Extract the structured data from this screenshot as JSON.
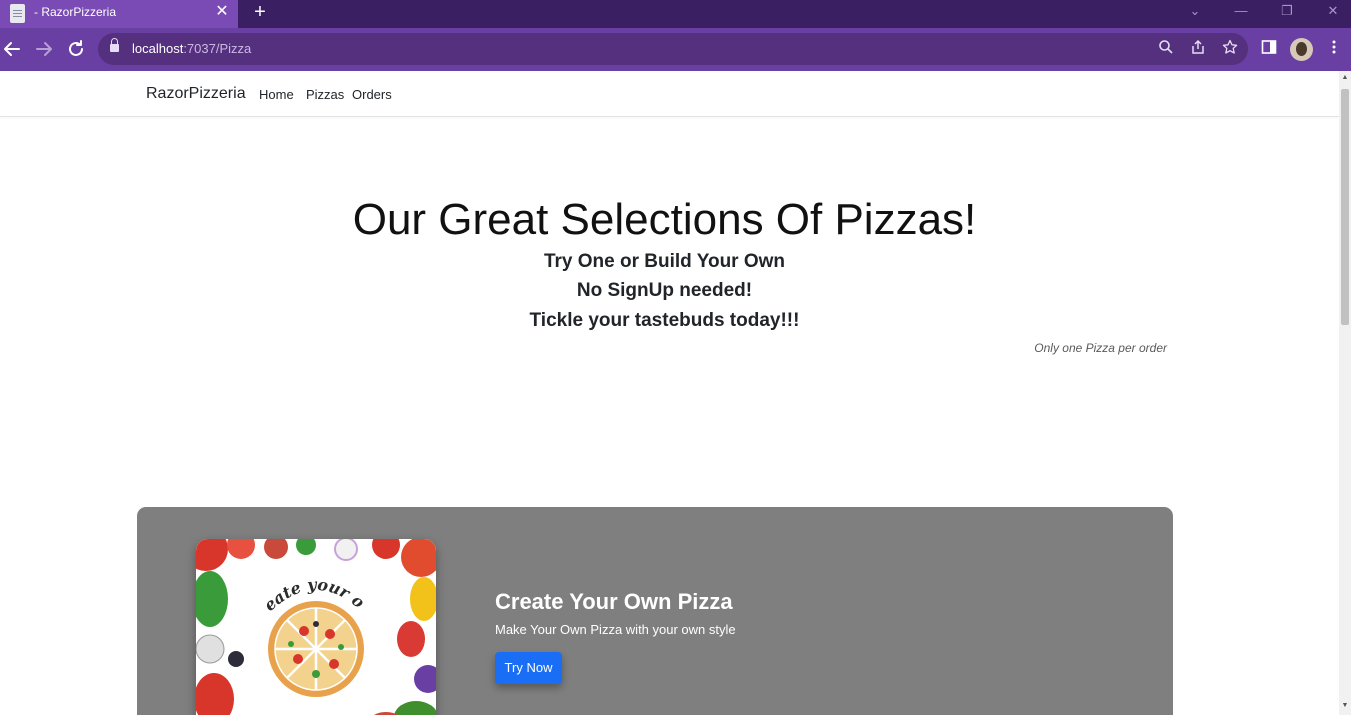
{
  "browser": {
    "tab_title": " - RazorPizzeria",
    "tab_close": "✕",
    "new_tab": "+",
    "url_host": "localhost",
    "url_rest": ":7037/Pizza",
    "window_controls": [
      "⌄",
      "—",
      "❐",
      "✕"
    ]
  },
  "navbar": {
    "brand": "RazorPizzeria",
    "links": [
      "Home",
      "Pizzas",
      "Orders"
    ]
  },
  "hero": {
    "title": "Our Great Selections Of Pizzas!",
    "lines": [
      "Try One or Build Your Own",
      "No SignUp needed!",
      "Tickle your tastebuds today!!!"
    ],
    "note": "Only one Pizza per order"
  },
  "card": {
    "image_caption": "Create your own",
    "title": "Create Your Own Pizza",
    "subtitle": "Make Your Own Pizza with your own style",
    "button": "Try Now"
  },
  "colors": {
    "tab_active": "#7a4bb5",
    "toolbar": "#6a3fa3",
    "card_bg": "#7f7f7f",
    "button": "#1a6ef5"
  }
}
